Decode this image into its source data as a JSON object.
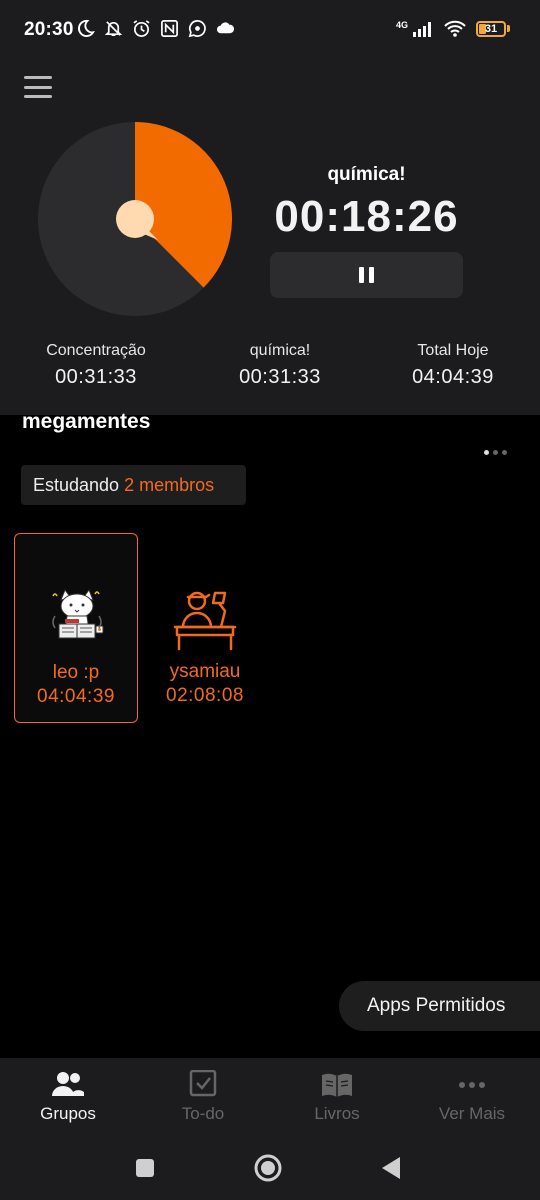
{
  "status_bar": {
    "time": "20:30",
    "network": "4G",
    "battery": "31",
    "left_icons": [
      "moon-icon",
      "bell-off-icon",
      "alarm-icon",
      "nfc-icon",
      "whatsapp-icon",
      "cloud-icon"
    ],
    "right_icons": [
      "signal-icon",
      "wifi-icon",
      "battery-icon"
    ]
  },
  "timer_panel": {
    "subject": "química!",
    "timer": "00:18:26",
    "pie_progress_fraction": 0.375,
    "colors": {
      "progress": "#F26B00",
      "track": "#2C2C2E",
      "center": "#FFDAB0"
    }
  },
  "stats": [
    {
      "label": "Concentração",
      "value": "00:31:33"
    },
    {
      "label": "química!",
      "value": "00:31:33"
    },
    {
      "label": "Total Hoje",
      "value": "04:04:39"
    }
  ],
  "group": {
    "name": "megamentes",
    "studying_label": "Estudando",
    "members_count_label": "2 membros",
    "members": [
      {
        "name": "leo :p",
        "time": "04:04:39",
        "avatar": "cat-reading-avatar",
        "active": true
      },
      {
        "name": "ysamiau",
        "time": "02:08:08",
        "avatar": "person-at-desk-avatar",
        "active": false
      }
    ]
  },
  "apps_button": "Apps Permitidos",
  "bottom_nav": [
    {
      "label": "Grupos",
      "icon": "group-icon",
      "active": true
    },
    {
      "label": "To-do",
      "icon": "checkbox-icon",
      "active": false
    },
    {
      "label": "Livros",
      "icon": "book-icon",
      "active": false
    },
    {
      "label": "Ver Mais",
      "icon": "more-icon",
      "active": false
    }
  ],
  "accent_color": "#F26B1D"
}
